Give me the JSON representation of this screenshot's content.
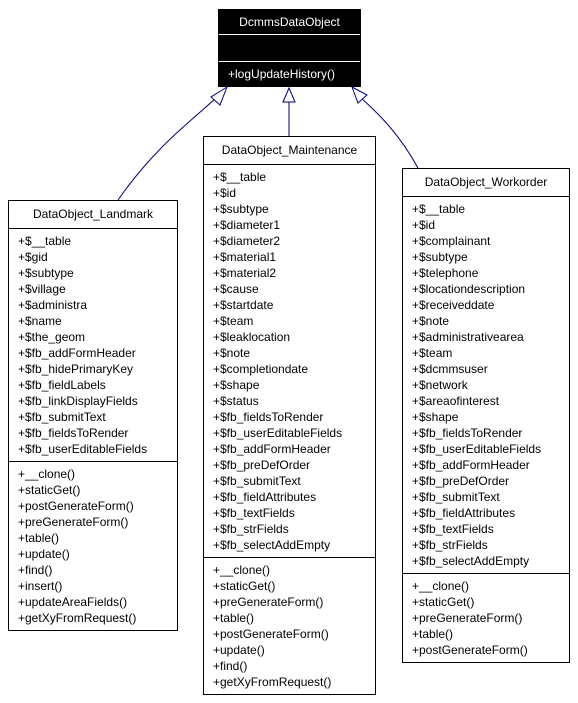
{
  "colors": {
    "edge": "#000080",
    "highlight_bg": "#000000",
    "highlight_text": "#ffffff"
  },
  "classes": [
    {
      "id": "dcmms",
      "name": "DcmmsDataObject",
      "highlighted": true,
      "attributes": [],
      "methods": [
        "+logUpdateHistory()"
      ]
    },
    {
      "id": "landmark",
      "name": "DataObject_Landmark",
      "parent": "DcmmsDataObject",
      "attributes": [
        "+$__table",
        "+$gid",
        "+$subtype",
        "+$village",
        "+$administra",
        "+$name",
        "+$the_geom",
        "+$fb_addFormHeader",
        "+$fb_hidePrimaryKey",
        "+$fb_fieldLabels",
        "+$fb_linkDisplayFields",
        "+$fb_submitText",
        "+$fb_fieldsToRender",
        "+$fb_userEditableFields"
      ],
      "methods": [
        "+__clone()",
        "+staticGet()",
        "+postGenerateForm()",
        "+preGenerateForm()",
        "+table()",
        "+update()",
        "+find()",
        "+insert()",
        "+updateAreaFields()",
        "+getXyFromRequest()"
      ]
    },
    {
      "id": "maintenance",
      "name": "DataObject_Maintenance",
      "parent": "DcmmsDataObject",
      "attributes": [
        "+$__table",
        "+$id",
        "+$subtype",
        "+$diameter1",
        "+$diameter2",
        "+$material1",
        "+$material2",
        "+$cause",
        "+$startdate",
        "+$team",
        "+$leaklocation",
        "+$note",
        "+$completiondate",
        "+$shape",
        "+$status",
        "+$fb_fieldsToRender",
        "+$fb_userEditableFields",
        "+$fb_addFormHeader",
        "+$fb_preDefOrder",
        "+$fb_submitText",
        "+$fb_fieldAttributes",
        "+$fb_textFields",
        "+$fb_strFields",
        "+$fb_selectAddEmpty"
      ],
      "methods": [
        "+__clone()",
        "+staticGet()",
        "+preGenerateForm()",
        "+table()",
        "+postGenerateForm()",
        "+update()",
        "+find()",
        "+getXyFromRequest()"
      ]
    },
    {
      "id": "workorder",
      "name": "DataObject_Workorder",
      "parent": "DcmmsDataObject",
      "attributes": [
        "+$__table",
        "+$id",
        "+$complainant",
        "+$subtype",
        "+$telephone",
        "+$locationdescription",
        "+$receiveddate",
        "+$note",
        "+$administrativearea",
        "+$team",
        "+$dcmmsuser",
        "+$network",
        "+$areaofinterest",
        "+$shape",
        "+$fb_fieldsToRender",
        "+$fb_userEditableFields",
        "+$fb_addFormHeader",
        "+$fb_preDefOrder",
        "+$fb_submitText",
        "+$fb_fieldAttributes",
        "+$fb_textFields",
        "+$fb_strFields",
        "+$fb_selectAddEmpty"
      ],
      "methods": [
        "+__clone()",
        "+staticGet()",
        "+preGenerateForm()",
        "+table()",
        "+postGenerateForm()"
      ]
    }
  ]
}
